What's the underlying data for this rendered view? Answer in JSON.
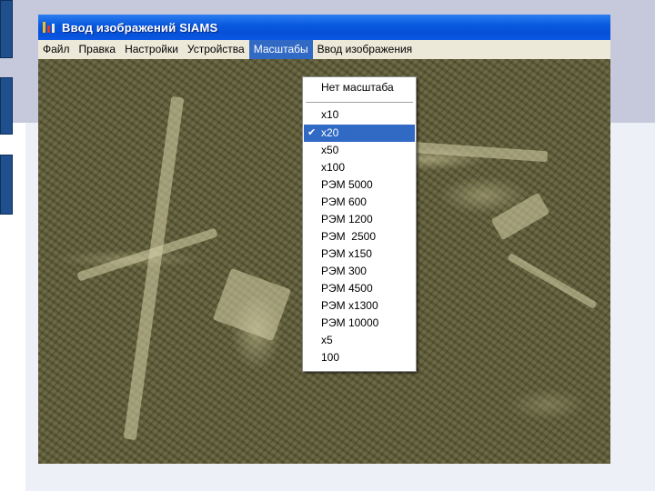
{
  "window": {
    "title": "Ввод изображений SIAMS"
  },
  "menubar": {
    "items": [
      {
        "label": "Файл"
      },
      {
        "label": "Правка"
      },
      {
        "label": "Настройки"
      },
      {
        "label": "Устройства"
      },
      {
        "label": "Масштабы",
        "active": true
      },
      {
        "label": "Ввод изображения"
      }
    ]
  },
  "dropdown": {
    "no_scale_label": "Нет масштаба",
    "check_icon": "✔",
    "selected_item": "x20",
    "items": [
      {
        "label": "x10"
      },
      {
        "label": "x20",
        "checked": true
      },
      {
        "label": "x50"
      },
      {
        "label": "x100"
      },
      {
        "label": "РЭМ 5000"
      },
      {
        "label": "РЭМ 600"
      },
      {
        "label": "РЭМ 1200"
      },
      {
        "label": "РЭМ  2500"
      },
      {
        "label": "РЭМ x150"
      },
      {
        "label": "РЭМ 300"
      },
      {
        "label": "РЭМ 4500"
      },
      {
        "label": "РЭМ x1300"
      },
      {
        "label": "РЭМ 10000"
      },
      {
        "label": "x5"
      },
      {
        "label": "100"
      }
    ]
  },
  "colors": {
    "titlebar": "#0a5ae0",
    "menu_highlight": "#316ac5",
    "menubar_bg": "#ece9d8",
    "image_bg": "#65623f"
  }
}
